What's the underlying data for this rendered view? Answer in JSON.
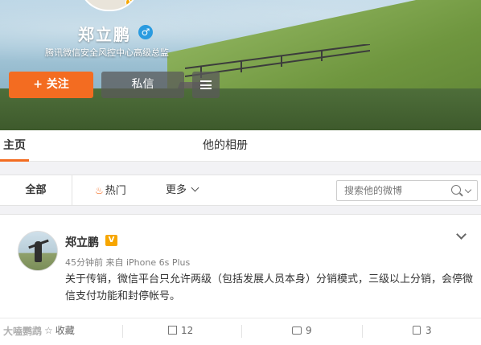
{
  "profile": {
    "name": "郑立鹏",
    "verified_mark": "V",
    "gender_symbol": "♂",
    "description": "腾讯微信安全风控中心高级总监",
    "follow_label": "关注",
    "follow_icon": "+",
    "message_label": "私信"
  },
  "tabs": {
    "home": "主页",
    "album": "他的相册"
  },
  "filters": {
    "all": "全部",
    "hot": "热门",
    "more": "更多",
    "search_placeholder": "搜索他的微博"
  },
  "post": {
    "author": "郑立鹏",
    "vip": "V",
    "meta": "45分钟前 来自 iPhone 6s Plus",
    "text": "关于传销，微信平台只允许两级（包括发展人员本身）分销模式，三级以上分销，会停微信支付功能和封停帐号。",
    "actions": {
      "favorite": "收藏",
      "reposts": "12",
      "comments": "9",
      "likes": "3"
    }
  },
  "watermark": "大嗑鹦鹉",
  "colors": {
    "accent": "#f36c21",
    "verified": "#f7a600",
    "gender": "#2a9be0"
  },
  "icons": [
    "menu-icon",
    "gender-male-icon",
    "flame-icon",
    "chevron-down-icon",
    "search-icon",
    "star-icon",
    "share-icon",
    "comment-icon",
    "like-icon"
  ]
}
